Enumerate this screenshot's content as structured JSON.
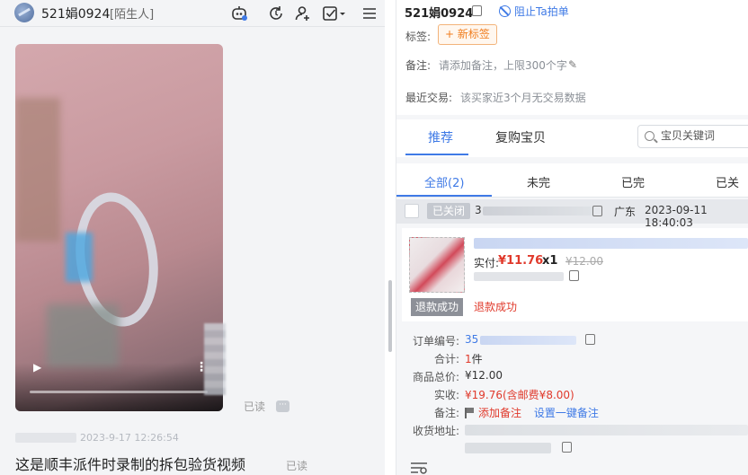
{
  "chat": {
    "contact_name": "521娟0924",
    "contact_tag": "[陌生人]",
    "header_icons": [
      "robot-icon",
      "refresh-icon",
      "add-user-icon",
      "check-square-icon",
      "menu-icon"
    ],
    "video_message": {
      "read_status": "已读"
    },
    "text_message": {
      "time": "2023-9-17 12:26:54",
      "text": "这是顺丰派件时录制的拆包验货视频",
      "read_status": "已读"
    }
  },
  "customer": {
    "name": "521娟0924",
    "block_label": "阻止Ta拍单",
    "tags_label": "标签:",
    "add_tag_button": "+ 新标签",
    "note_label": "备注:",
    "note_placeholder": "请添加备注，上限300个字",
    "recent_trade_label": "最近交易:",
    "recent_trade_value": "该买家近3个月无交易数据"
  },
  "product_tabs": {
    "items": [
      "推荐",
      "复购宝贝"
    ],
    "active": "推荐",
    "search_placeholder": "宝贝关键词"
  },
  "order_tabs": {
    "items": [
      "全部(2)",
      "未完",
      "已完",
      "已关"
    ],
    "active": "全部(2)"
  },
  "order": {
    "status": "已关闭",
    "order_no_prefix": "3",
    "region": "广东",
    "time": "2023-09-11 18:40:03",
    "item": {
      "paid_label": "实付:",
      "paid_amount": "¥11.76",
      "quantity": "x1",
      "original_price": "¥12.00",
      "refund_badge": "退款成功",
      "refund_status": "退款成功"
    },
    "details": {
      "order_no_label": "订单编号:",
      "order_no_prefix": "35",
      "total_label": "合计:",
      "total_count": "1",
      "total_unit": "件",
      "goods_total_label": "商品总价:",
      "goods_total": "¥12.00",
      "received_label": "实收:",
      "received": "¥19.76",
      "postage_note": "(含邮费¥8.00)",
      "remark_label": "备注:",
      "add_remark": "添加备注",
      "set_quick_remark": "设置一键备注",
      "address_label": "收货地址:"
    }
  },
  "colors": {
    "accent": "#3f7ae6",
    "price_red": "#e0392b",
    "tag_orange": "#f07d1e"
  }
}
